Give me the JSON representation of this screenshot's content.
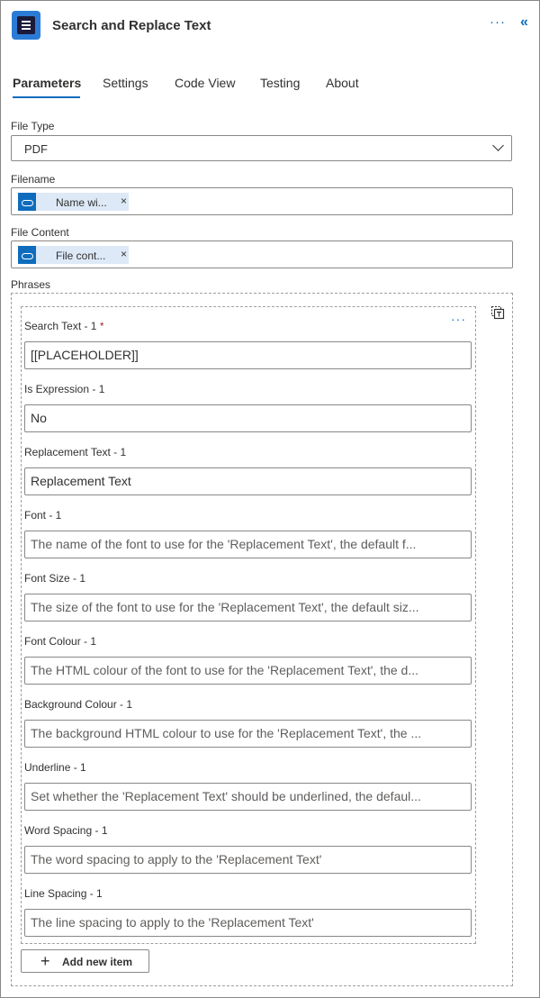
{
  "header": {
    "title": "Search and Replace Text",
    "more_glyph": "···",
    "collapse_glyph": "«",
    "app_icon": "encodian-app-icon"
  },
  "tabs": [
    {
      "label": "Parameters",
      "active": true
    },
    {
      "label": "Settings",
      "active": false
    },
    {
      "label": "Code View",
      "active": false
    },
    {
      "label": "Testing",
      "active": false
    },
    {
      "label": "About",
      "active": false
    }
  ],
  "file_type": {
    "label": "File Type",
    "value": "PDF"
  },
  "filename": {
    "label": "Filename",
    "token": "Name wi...",
    "remove": "×",
    "token_icon": "onedrive-icon"
  },
  "file_content": {
    "label": "File Content",
    "token": "File cont...",
    "remove": "×",
    "token_icon": "onedrive-icon"
  },
  "phrases": {
    "label": "Phrases",
    "item_more": "···",
    "fields": [
      {
        "label": "Search Text - 1",
        "required": "*",
        "value": "[[PLACEHOLDER]]",
        "placeholder": ""
      },
      {
        "label": "Is Expression - 1",
        "value": "No",
        "placeholder": ""
      },
      {
        "label": "Replacement Text - 1",
        "value": "Replacement Text",
        "placeholder": ""
      },
      {
        "label": "Font - 1",
        "value": "",
        "placeholder": "The name of the font to use for the 'Replacement Text', the default f..."
      },
      {
        "label": "Font Size - 1",
        "value": "",
        "placeholder": "The size of the font to use for the 'Replacement Text', the default siz..."
      },
      {
        "label": "Font Colour - 1",
        "value": "",
        "placeholder": "The HTML colour of the font to use for the 'Replacement Text', the d..."
      },
      {
        "label": "Background Colour - 1",
        "value": "",
        "placeholder": "The background HTML colour to use for the 'Replacement Text', the ..."
      },
      {
        "label": "Underline - 1",
        "value": "",
        "placeholder": "Set whether the 'Replacement Text' should be underlined, the defaul..."
      },
      {
        "label": "Word Spacing - 1",
        "value": "",
        "placeholder": "The word spacing to apply to the 'Replacement Text'"
      },
      {
        "label": "Line Spacing - 1",
        "value": "",
        "placeholder": "The line spacing to apply to the 'Replacement Text'"
      }
    ],
    "add_button": "Add new item"
  },
  "colors": {
    "accent": "#0f6cbd",
    "required": "#a4262c",
    "token_bg": "#dde9f7"
  }
}
